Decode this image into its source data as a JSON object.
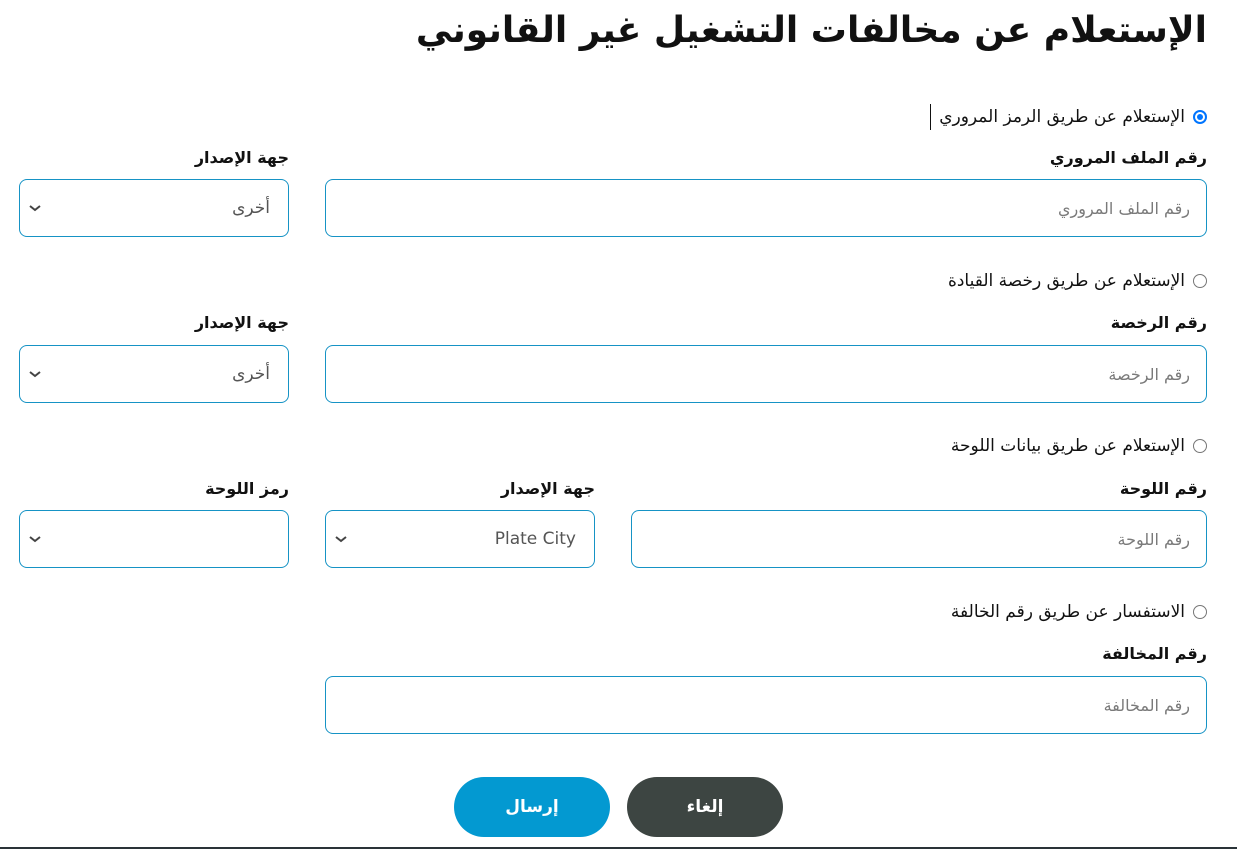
{
  "page": {
    "title": "الإستعلام عن مخالفات التشغيل غير القانوني"
  },
  "options": [
    {
      "radio_label": "الإستعلام عن طريق الرمز المروري",
      "checked": true,
      "fields": {
        "number_label": "رقم الملف المروري",
        "number_placeholder": "رقم الملف المروري",
        "number_value": "",
        "issuer_label": "جهة الإصدار",
        "issuer_value": "أخرى"
      }
    },
    {
      "radio_label": "الإستعلام عن طريق رخصة القيادة",
      "checked": false,
      "fields": {
        "number_label": "رقم الرخصة",
        "number_placeholder": "رقم الرخصة",
        "number_value": "",
        "issuer_label": "جهة الإصدار",
        "issuer_value": "أخرى"
      }
    },
    {
      "radio_label": "الإستعلام عن طريق بيانات اللوحة",
      "checked": false,
      "fields": {
        "number_label": "رقم اللوحة",
        "number_placeholder": "رقم اللوحة",
        "number_value": "",
        "issuer_label": "جهة الإصدار",
        "issuer_value": "Plate City",
        "code_label": "رمز اللوحة",
        "code_value": ""
      }
    },
    {
      "radio_label": "الاستفسار عن طريق رقم الخالفة",
      "checked": false,
      "fields": {
        "number_label": "رقم المخالفة",
        "number_placeholder": "رقم المخالفة",
        "number_value": ""
      }
    }
  ],
  "buttons": {
    "submit": "إرسال",
    "cancel": "إلغاء"
  },
  "colors": {
    "accent": "#0399d1",
    "field_border": "#1693c5",
    "cancel": "#3d4542",
    "radio_checked": "#0075ff"
  }
}
